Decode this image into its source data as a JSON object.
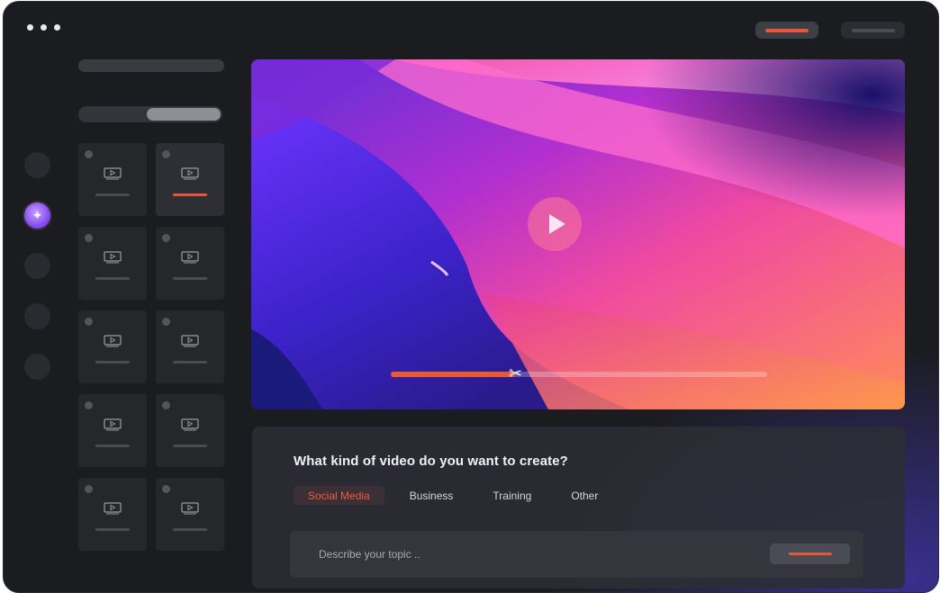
{
  "window": {
    "dots": [
      "dot-1",
      "dot-2",
      "dot-3"
    ]
  },
  "top_actions": {
    "primary_icon": "primary-action-bar",
    "secondary_icon": "secondary-action-bar"
  },
  "sidebar_rail": {
    "items": [
      {
        "name": "rail-item-1",
        "active": false
      },
      {
        "name": "rail-item-ai",
        "active": true,
        "icon": "sparkle-icon"
      },
      {
        "name": "rail-item-3",
        "active": false
      },
      {
        "name": "rail-item-4",
        "active": false
      },
      {
        "name": "rail-item-5",
        "active": false
      }
    ]
  },
  "library": {
    "thumbnails": [
      {
        "selected": false
      },
      {
        "selected": true
      },
      {
        "selected": false
      },
      {
        "selected": false
      },
      {
        "selected": false
      },
      {
        "selected": false
      },
      {
        "selected": false
      },
      {
        "selected": false
      },
      {
        "selected": false
      },
      {
        "selected": false
      }
    ],
    "thumbnail_icon": "video-icon"
  },
  "player": {
    "play_icon": "play-icon",
    "progress": 0.33,
    "cut_icon": "scissors-icon",
    "accent_color": "#ea5a2e"
  },
  "prompt": {
    "title": "What kind of video do you want to create?",
    "categories": [
      {
        "label": "Social Media",
        "active": true
      },
      {
        "label": "Business",
        "active": false
      },
      {
        "label": "Training",
        "active": false
      },
      {
        "label": "Other",
        "active": false
      }
    ],
    "input": {
      "placeholder": "Describe your topic .."
    }
  }
}
